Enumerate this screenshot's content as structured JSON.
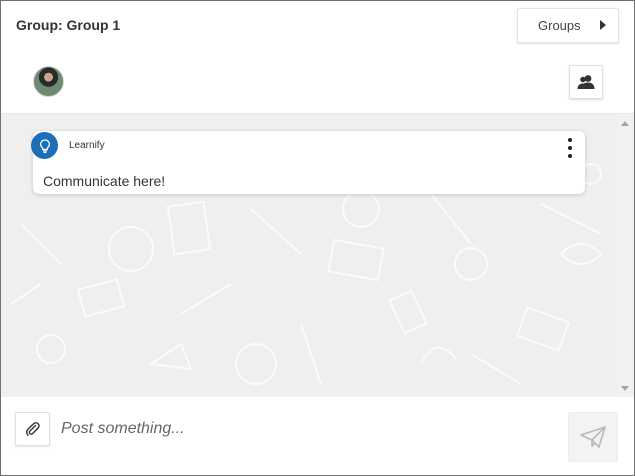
{
  "header": {
    "group_title": "Group: Group 1",
    "groups_button_label": "Groups"
  },
  "members": {
    "avatar_icon": "user-avatar",
    "members_button_icon": "users-icon"
  },
  "messages": [
    {
      "sender": "Learnify",
      "sender_icon": "lightbulb-icon",
      "text": "Communicate here!"
    }
  ],
  "composer": {
    "placeholder": "Post something...",
    "attach_icon": "paperclip-icon",
    "send_icon": "paper-plane-icon"
  },
  "colors": {
    "brand_blue": "#1c6fb7",
    "chat_background": "#efefef"
  }
}
